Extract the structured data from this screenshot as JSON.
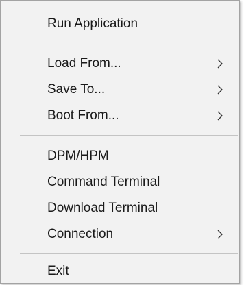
{
  "menu": {
    "items": [
      {
        "label": "Run Application",
        "submenu": false
      },
      {
        "label": "Load From...",
        "submenu": true
      },
      {
        "label": "Save To...",
        "submenu": true
      },
      {
        "label": "Boot From...",
        "submenu": true
      },
      {
        "label": "DPM/HPM",
        "submenu": false
      },
      {
        "label": "Command Terminal",
        "submenu": false
      },
      {
        "label": "Download Terminal",
        "submenu": false
      },
      {
        "label": "Connection",
        "submenu": true
      },
      {
        "label": "Exit",
        "submenu": false
      }
    ],
    "submenu_icon": "chevron-right-icon"
  }
}
